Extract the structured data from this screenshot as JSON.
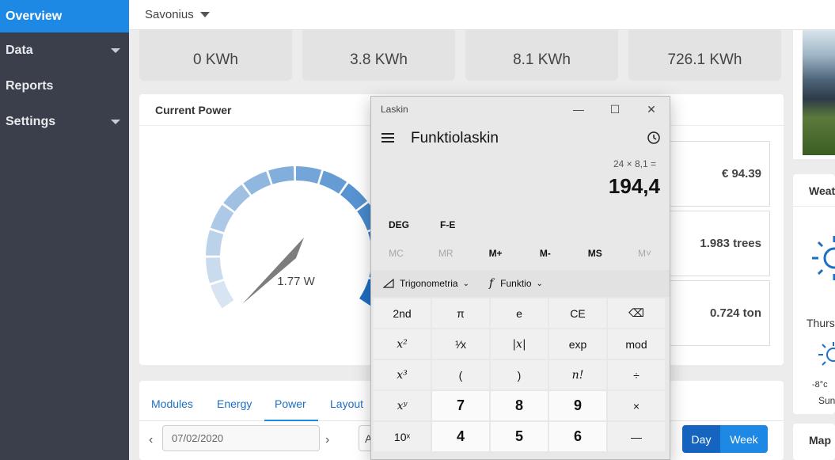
{
  "sidebar": {
    "items": [
      {
        "label": "Overview"
      },
      {
        "label": "Data"
      },
      {
        "label": "Reports"
      },
      {
        "label": "Settings"
      }
    ]
  },
  "topbar": {
    "site": "Savonius"
  },
  "kpis": [
    "0 KWh",
    "3.8 KWh",
    "8.1 KWh",
    "726.1 KWh"
  ],
  "current_power": {
    "title": "Current Power",
    "value": "1.77 W"
  },
  "stats": [
    "€ 94.39",
    "1.983 trees",
    "0.724 ton"
  ],
  "tabs": [
    "Modules",
    "Energy",
    "Power",
    "Layout"
  ],
  "active_tab": "Power",
  "date": "07/02/2020",
  "range_buttons": {
    "day": "Day",
    "week": "Week",
    "partial": "A"
  },
  "weather": {
    "title": "Weat",
    "day": "Thurs",
    "temp": "-8°c",
    "cond": "Sun"
  },
  "map": {
    "title": "Map"
  },
  "calculator": {
    "window_title": "Laskin",
    "mode": "Funktiolaskin",
    "expression": "24 × 8,1 =",
    "result": "194,4",
    "deg": "DEG",
    "fe": "F-E",
    "memory": [
      "MC",
      "MR",
      "M+",
      "M-",
      "MS",
      "M˅"
    ],
    "trig": "Trigonometria",
    "func": "Funktio",
    "keys": [
      [
        "2nd",
        "π",
        "e",
        "CE",
        "⌫"
      ],
      [
        "x²",
        "¹⁄x",
        "|x|",
        "exp",
        "mod"
      ],
      [
        "x³",
        "(",
        ")",
        "n!",
        "÷"
      ],
      [
        "xʸ",
        "7",
        "8",
        "9",
        "×"
      ],
      [
        "10ˣ",
        "4",
        "5",
        "6",
        "—"
      ]
    ]
  },
  "colors": {
    "sidebar": "#3a3f4b",
    "accent": "#1e88e5",
    "gauge_light": "#d8e4f2",
    "gauge_dark": "#1e6fc2"
  }
}
